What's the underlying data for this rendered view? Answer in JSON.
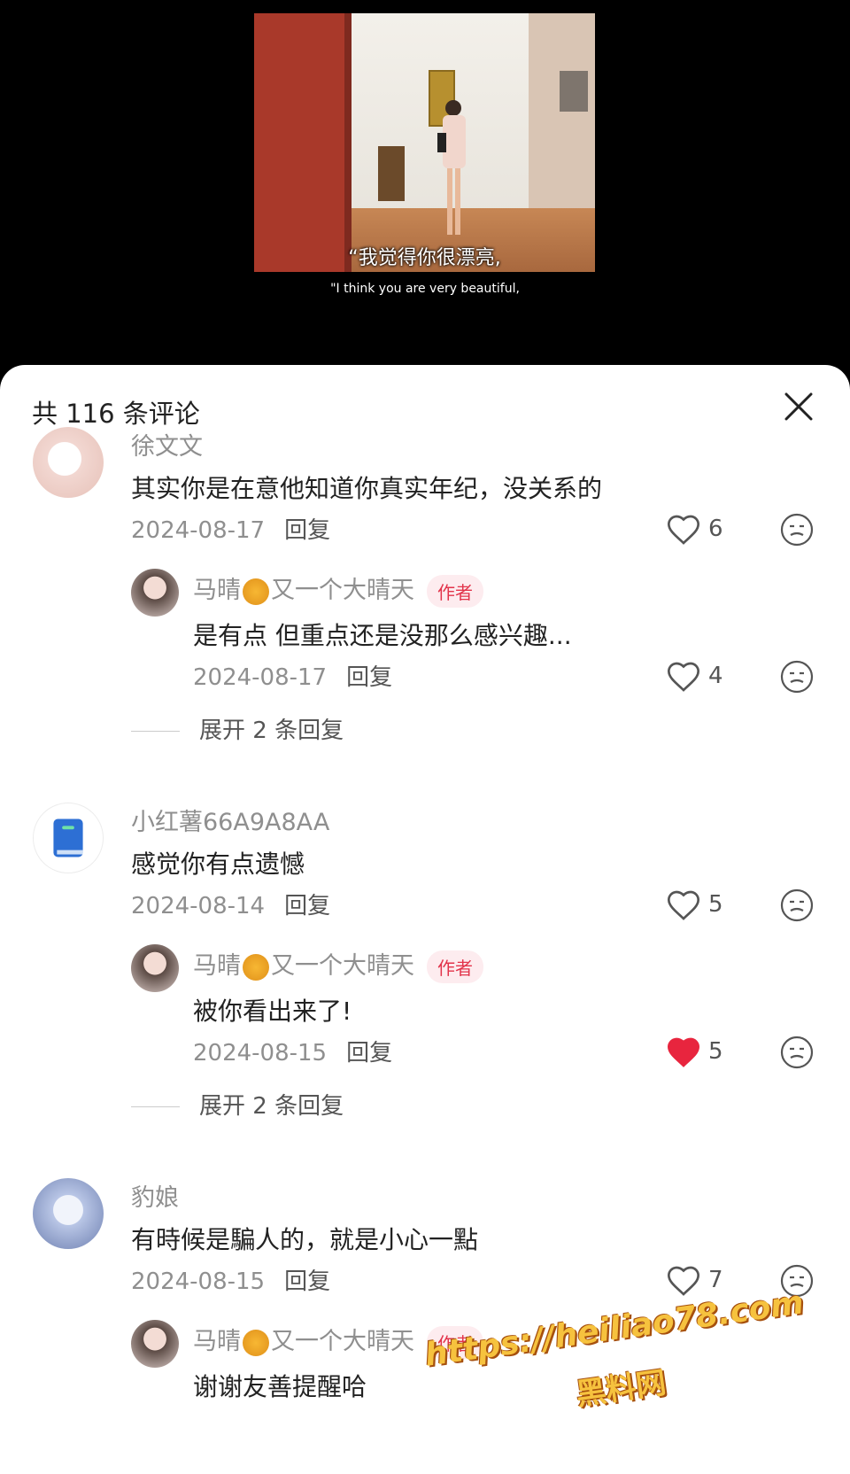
{
  "video": {
    "subtitle_cn": "“我觉得你很漂亮,",
    "subtitle_en": "\"I think you are very beautiful,"
  },
  "comments_header": {
    "count_text": "共 116 条评论"
  },
  "comments": [
    {
      "name": "徐文文",
      "text": "其实你是在意他知道你真实年纪，没关系的",
      "date": "2024-08-17",
      "reply_label": "回复",
      "likes": "6",
      "liked": false,
      "replies": [
        {
          "name_a": "马晴",
          "name_b": "又一个大晴天",
          "badge": "作者",
          "text": "是有点 但重点还是没那么感兴趣...",
          "date": "2024-08-17",
          "reply_label": "回复",
          "likes": "4",
          "liked": false
        }
      ],
      "expand": "展开 2 条回复"
    },
    {
      "name": "小红薯66A9A8AA",
      "text": "感觉你有点遗憾",
      "date": "2024-08-14",
      "reply_label": "回复",
      "likes": "5",
      "liked": false,
      "replies": [
        {
          "name_a": "马晴",
          "name_b": "又一个大晴天",
          "badge": "作者",
          "text": "被你看出来了!",
          "date": "2024-08-15",
          "reply_label": "回复",
          "likes": "5",
          "liked": true
        }
      ],
      "expand": "展开 2 条回复"
    },
    {
      "name": "豹娘",
      "text": "有時候是騙人的，就是小心一點",
      "date": "2024-08-15",
      "reply_label": "回复",
      "likes": "7",
      "liked": false,
      "replies": [
        {
          "name_a": "马晴",
          "name_b": "又一个大晴天",
          "badge": "作者",
          "text": "谢谢友善提醒哈"
        }
      ]
    }
  ],
  "watermark": {
    "line1": "https://heiliao78.com",
    "line2": "黑料网"
  },
  "colors": {
    "like_red": "#e8253e",
    "author_badge_bg": "#fdecef",
    "author_badge_text": "#e2344b"
  },
  "icons": [
    "back-icon",
    "close-icon",
    "heart-icon",
    "emoji-icon",
    "book-icon"
  ]
}
